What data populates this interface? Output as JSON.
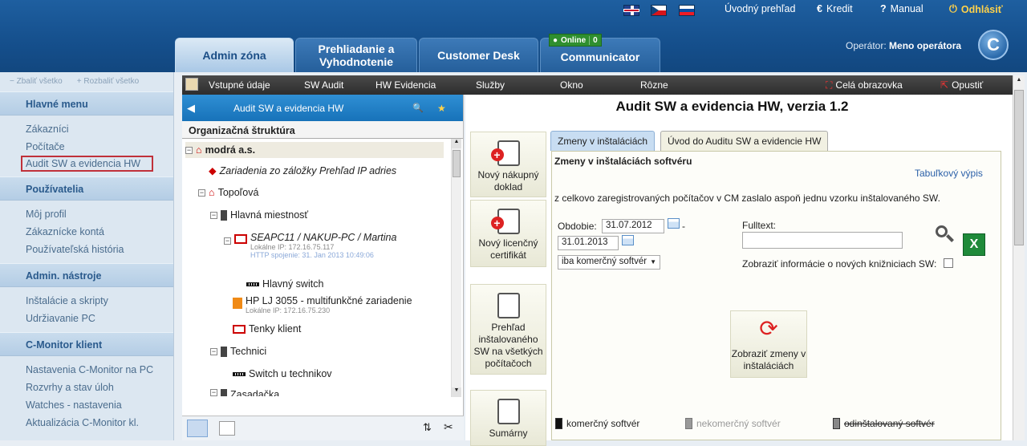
{
  "header": {
    "nav_home": "Úvodný prehľad",
    "nav_credit": "Kredit",
    "nav_manual": "Manual",
    "nav_logout": "Odhlásiť",
    "tabs": [
      "Admin zóna",
      "Prehliadanie a\nVyhodnotenie",
      "Customer Desk",
      "Communicator"
    ],
    "online_label": "Online",
    "online_count": "0",
    "operator_label": "Operátor:",
    "operator_name": "Meno operátora",
    "logo_letter": "C"
  },
  "sidebar": {
    "collapse_all": "Zbaliť všetko",
    "expand_all": "Rozbaliť všetko",
    "sections": [
      {
        "title": "Hlavné menu",
        "items": [
          "Zákazníci",
          "Počítače",
          "Audit SW a evidencia HW"
        ]
      },
      {
        "title": "Používatelia",
        "items": [
          "Môj profil",
          "Zákaznícke kontá",
          "Používateľská história"
        ]
      },
      {
        "title": "Admin. nástroje",
        "items": [
          "Inštalácie a skripty",
          "Udržiavanie PC"
        ]
      },
      {
        "title": "C-Monitor klient",
        "items": [
          "Nastavenia C-Monitor na PC",
          "Rozvrhy a stav úloh",
          "Watches - nastavenia",
          "Aktualizácia C-Monitor kl."
        ]
      }
    ]
  },
  "menubar": {
    "items": [
      "Vstupné údaje",
      "SW Audit",
      "HW Evidencia",
      "Služby",
      "Okno",
      "Rôzne"
    ],
    "fullscreen": "Celá obrazovka",
    "exit": "Opustiť"
  },
  "leftpanel": {
    "title": "Audit SW a evidencia HW",
    "org_title": "Organizačná štruktúra",
    "tree": {
      "root": "modrá a.s.",
      "ip_devices": "Zariadenia zo záložky Prehľad IP adries",
      "topolova": "Topoľová",
      "main_room": "Hlavná miestnosť",
      "pc_name": "SEAPC11 / NAKUP-PC / Martina",
      "pc_ip": "Lokálne IP: 172.16.75.117",
      "pc_http": "HTTP spojenie: 31. Jan 2013 10:49:06",
      "switch_main": "Hlavný switch",
      "printer": "HP LJ 3055 - multifunkčné zariadenie",
      "printer_ip": "Lokálne IP: 172.16.75.230",
      "thin_client": "Tenky klient",
      "technici": "Technici",
      "switch_tech": "Switch u technikov",
      "cut_node": "Zasadačka"
    }
  },
  "main": {
    "title": "Audit SW a evidencia HW, verzia 1.2",
    "actions": [
      "Nový nákupný doklad",
      "Nový licenčný certifikát",
      "Prehľad inštalovaného SW na všetkých počítačoch",
      "Sumárny"
    ],
    "subtabs": [
      "Zmeny v inštaláciách",
      "Úvod do Auditu SW a evidencie HW"
    ],
    "section_title": "Zmeny v inštaláciách softvéru",
    "table_link": "Tabuľkový výpis",
    "info_text": "z celkovo zaregistrovaných počítačov v CM zaslalo aspoň jednu vzorku inštalovaného SW.",
    "period_label": "Obdobie:",
    "date_from": "31.07.2012",
    "date_to": "31.01.2013",
    "dash": "-",
    "sw_filter": "iba komerčný softvér",
    "fulltext_label": "Fulltext:",
    "fulltext_value": "",
    "new_libs_label": "Zobraziť informácie o nových knižniciach SW:",
    "show_changes": "Zobraziť zmeny v inštaláciách",
    "legend": [
      "komerčný softvér",
      "nekomerčný softvér",
      "odinštalovaný softvér"
    ]
  }
}
